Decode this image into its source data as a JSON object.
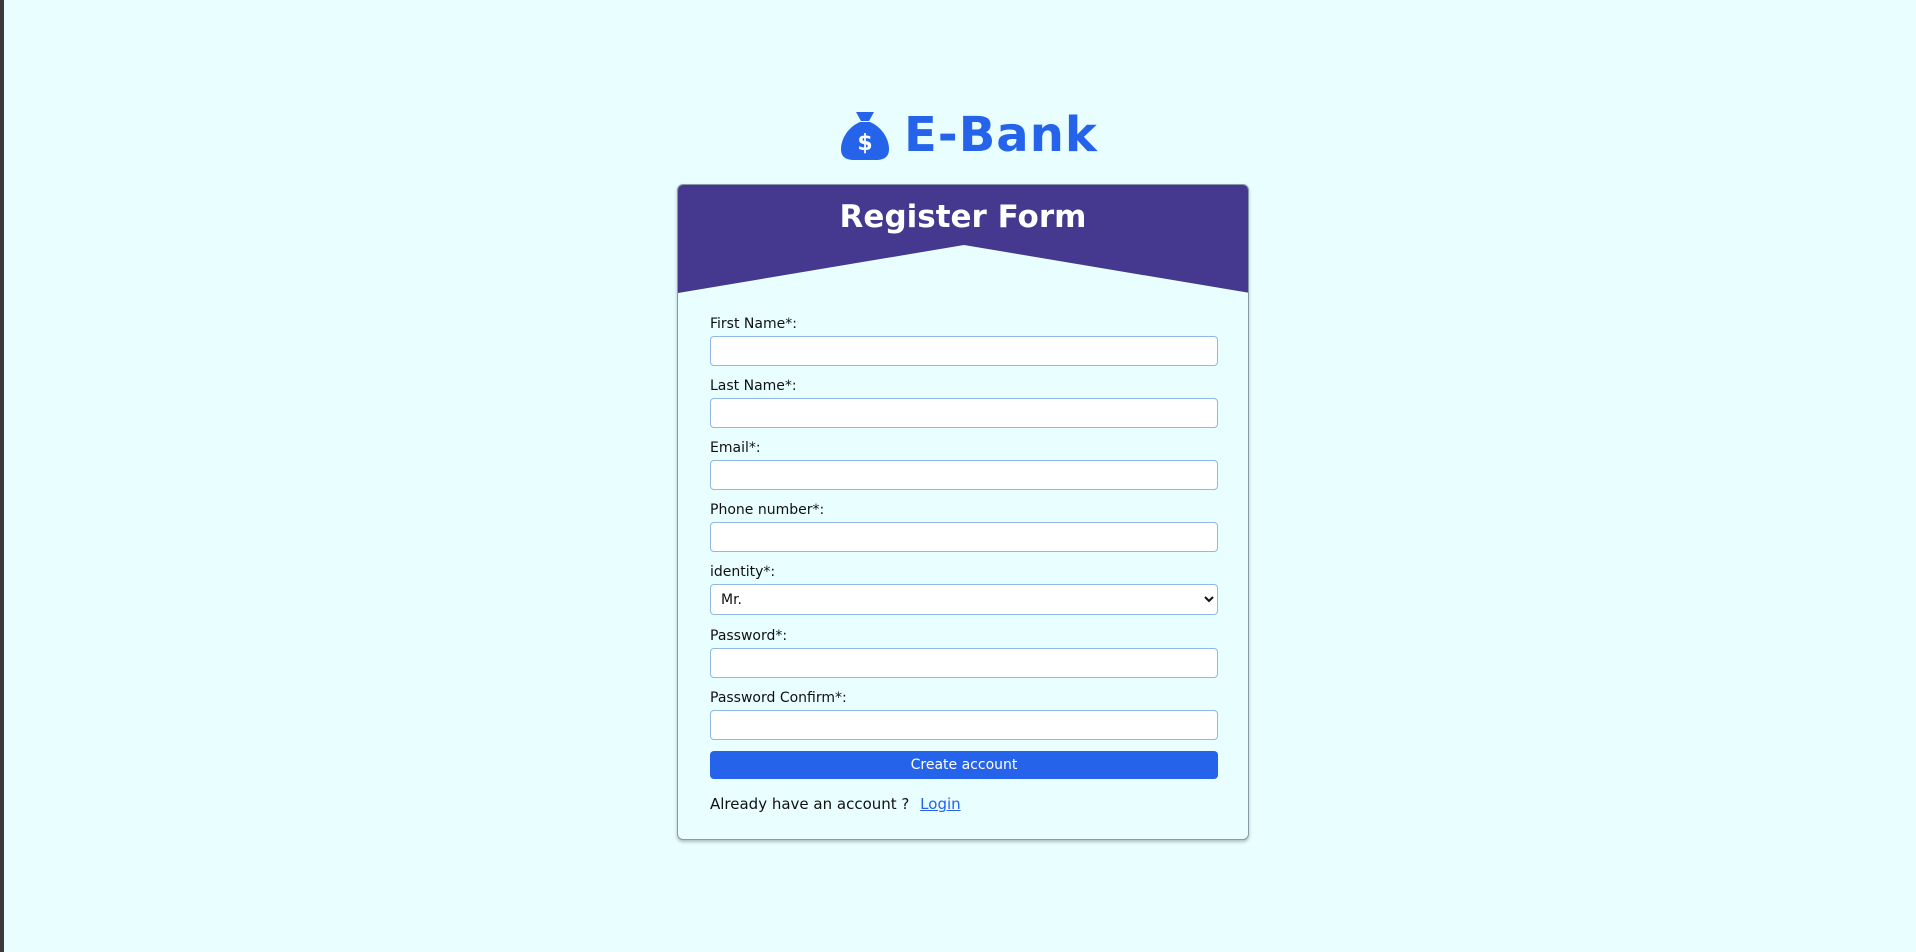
{
  "brand": {
    "name": "E-Bank",
    "icon": "money-bag-icon",
    "color": "#2563eb"
  },
  "card": {
    "title": "Register Form",
    "header_color": "#44398f"
  },
  "form": {
    "first_name_label": "First Name*:",
    "last_name_label": "Last Name*:",
    "email_label": "Email*:",
    "phone_label": "Phone number*:",
    "identity_label": "identity*:",
    "identity_selected": "Mr.",
    "password_label": "Password*:",
    "password_confirm_label": "Password Confirm*:",
    "submit_label": "Create account",
    "footer_text": "Already have an account ?",
    "login_link": "Login"
  }
}
